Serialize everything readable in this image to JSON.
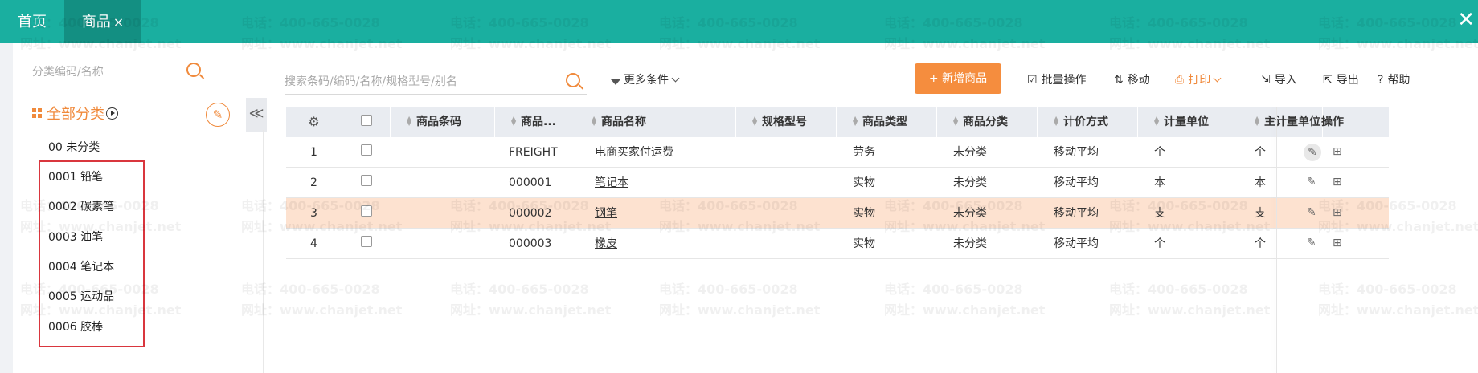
{
  "tabs": {
    "home": "首页",
    "goods": "商品",
    "close_glyph": "×"
  },
  "window": {
    "close_glyph": "✕"
  },
  "sidebar": {
    "search_placeholder": "分类编码/名称",
    "root_label": "全部分类",
    "items": [
      "00 未分类",
      "0001 铅笔",
      "0002 碳素笔",
      "0003 油笔",
      "0004 笔记本",
      "0005 运动品",
      "0006 胶棒"
    ]
  },
  "collapse_glyph": "≪",
  "toolbar": {
    "search_placeholder": "搜索条码/编码/名称/规格型号/别名",
    "more_conditions": "更多条件",
    "add_button": "新增商品",
    "add_icon": "+",
    "batch": "批量操作",
    "move": "移动",
    "print": "打印",
    "import": "导入",
    "export": "导出",
    "help": "帮助"
  },
  "table": {
    "headers": {
      "barcode": "商品条码",
      "code": "商品...",
      "name": "商品名称",
      "spec": "规格型号",
      "type": "商品类型",
      "category": "商品分类",
      "valuation": "计价方式",
      "unit": "计量单位",
      "main_unit": "主计量单位",
      "actions": "操作"
    },
    "rows": [
      {
        "no": "1",
        "barcode": "",
        "code": "FREIGHT",
        "name": "电商买家付运费",
        "spec": "",
        "type": "劳务",
        "category": "未分类",
        "valuation": "移动平均",
        "unit": "个",
        "main_unit": "个"
      },
      {
        "no": "2",
        "barcode": "",
        "code": "000001",
        "name": "笔记本",
        "spec": "",
        "type": "实物",
        "category": "未分类",
        "valuation": "移动平均",
        "unit": "本",
        "main_unit": "本"
      },
      {
        "no": "3",
        "barcode": "",
        "code": "000002",
        "name": "钢笔",
        "spec": "",
        "type": "实物",
        "category": "未分类",
        "valuation": "移动平均",
        "unit": "支",
        "main_unit": "支"
      },
      {
        "no": "4",
        "barcode": "",
        "code": "000003",
        "name": "橡皮",
        "spec": "",
        "type": "实物",
        "category": "未分类",
        "valuation": "移动平均",
        "unit": "个",
        "main_unit": "个"
      }
    ]
  },
  "watermark": {
    "phone": "电话：400-665-0028",
    "site": "网址：www.chanjet.net"
  },
  "colors": {
    "teal": "#1aafa0",
    "teal_dark": "#138f82",
    "orange": "#f58d3e",
    "highlight_row": "#fde2d0",
    "red_box": "#d9363e"
  },
  "icons": [
    "search-icon",
    "category-grid-icon",
    "play-circle-icon",
    "edit-icon",
    "collapse-left-icon",
    "filter-icon",
    "chevron-down-icon",
    "batch-icon",
    "move-icon",
    "print-icon",
    "import-icon",
    "export-icon",
    "help-icon",
    "gear-icon",
    "more-icon",
    "close-icon"
  ]
}
